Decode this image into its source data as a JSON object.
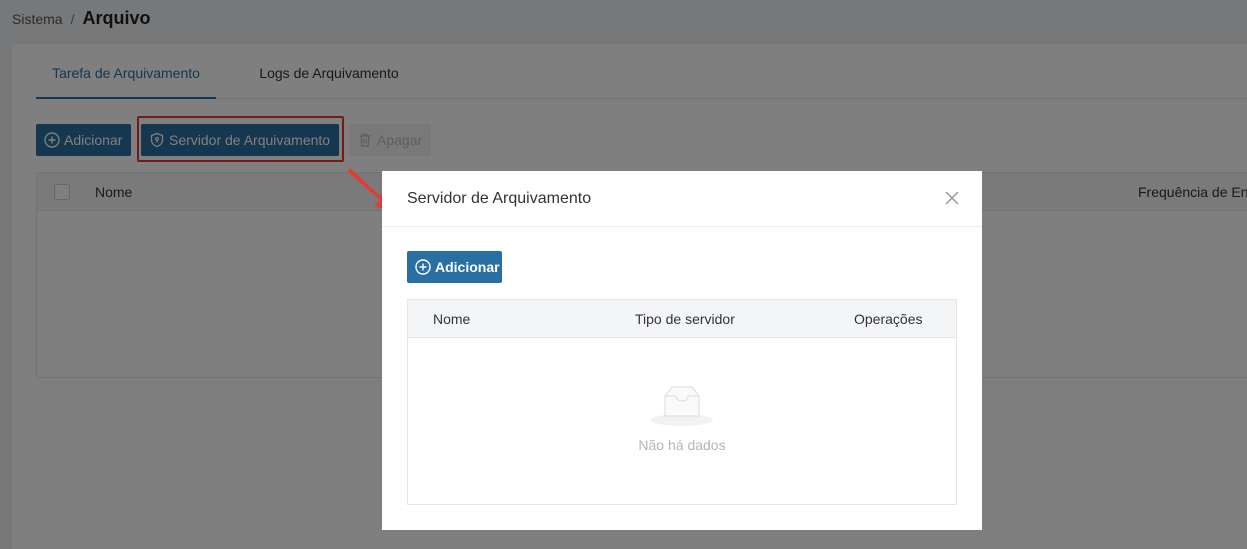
{
  "breadcrumb": {
    "parent": "Sistema",
    "separator": "/",
    "current": "Arquivo"
  },
  "tabs": [
    {
      "label": "Tarefa de Arquivamento",
      "active": true
    },
    {
      "label": "Logs de Arquivamento",
      "active": false
    }
  ],
  "toolbar": {
    "add_label": "Adicionar",
    "server_label": "Servidor de Arquivamento",
    "delete_label": "Apagar"
  },
  "table": {
    "columns": [
      "Nome",
      "Frequência de En"
    ]
  },
  "modal": {
    "title": "Servidor de Arquivamento",
    "add_label": "Adicionar",
    "columns": [
      "Nome",
      "Tipo de servidor",
      "Operações"
    ],
    "empty_text": "Não há dados"
  },
  "colors": {
    "primary": "#2a6fa1",
    "highlight": "#e53935"
  },
  "icons": [
    "plus-circle-icon",
    "shield-icon",
    "trash-icon",
    "close-icon",
    "inbox-icon",
    "arrow-icon"
  ]
}
